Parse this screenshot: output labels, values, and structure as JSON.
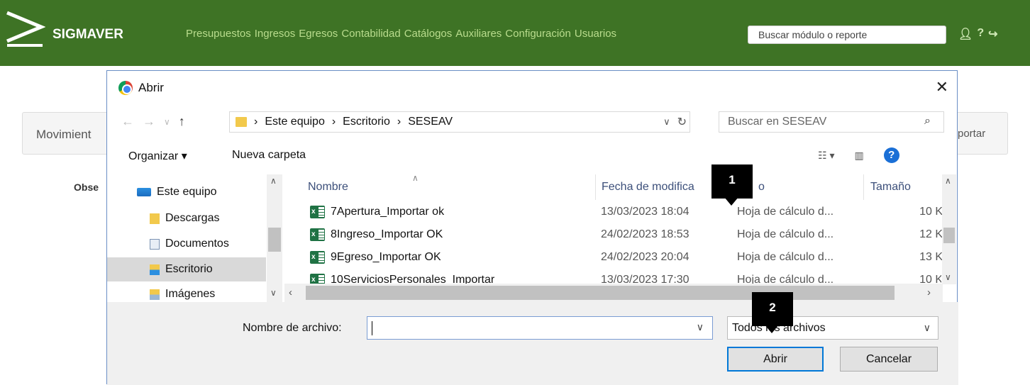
{
  "app": {
    "brand": "SIGMAVER"
  },
  "nav": [
    "Presupuestos",
    "Ingresos",
    "Egresos",
    "Contabilidad",
    "Catálogos",
    "Auxiliares",
    "Configuración",
    "Usuarios"
  ],
  "search": {
    "placeholder": "Buscar módulo o reporte"
  },
  "panel": {
    "title": "Movimient",
    "right": "portar"
  },
  "obs_label": "Obse",
  "dialog": {
    "title": "Abrir",
    "close": "✕",
    "breadcrumb": [
      "Este equipo",
      "Escritorio",
      "SESEAV"
    ],
    "search_placeholder": "Buscar en SESEAV",
    "organize": "Organizar ▾",
    "new_folder": "Nueva carpeta",
    "tree": [
      {
        "label": "Este equipo",
        "icon": "computer-icon"
      },
      {
        "label": "Descargas",
        "icon": "downloads-icon"
      },
      {
        "label": "Documentos",
        "icon": "documents-icon"
      },
      {
        "label": "Escritorio",
        "icon": "desktop-icon",
        "selected": true
      },
      {
        "label": "Imágenes",
        "icon": "pictures-icon"
      }
    ],
    "columns": {
      "name": "Nombre",
      "date": "Fecha de modifica",
      "type": "o",
      "size": "Tamaño"
    },
    "files": [
      {
        "name": "7Apertura_Importar ok",
        "date": "13/03/2023 18:04",
        "type": "Hoja de cálculo d...",
        "size": "10 K"
      },
      {
        "name": "8Ingreso_Importar OK",
        "date": "24/02/2023 18:53",
        "type": "Hoja de cálculo d...",
        "size": "12 K"
      },
      {
        "name": "9Egreso_Importar OK",
        "date": "24/02/2023 20:04",
        "type": "Hoja de cálculo d...",
        "size": "13 K"
      },
      {
        "name": "10ServiciosPersonales_Importar",
        "date": "13/03/2023 17:30",
        "type": "Hoja de cálculo d...",
        "size": "10 K"
      }
    ],
    "filename_label": "Nombre de archivo:",
    "filename_value": "",
    "filetype": "Todos los archivos",
    "open_button": "Abrir",
    "cancel_button": "Cancelar"
  },
  "callouts": [
    "1",
    "2"
  ],
  "colors": {
    "topbar": "#3e7325",
    "nav_link": "#b9dc8d",
    "accent": "#0078d7"
  }
}
